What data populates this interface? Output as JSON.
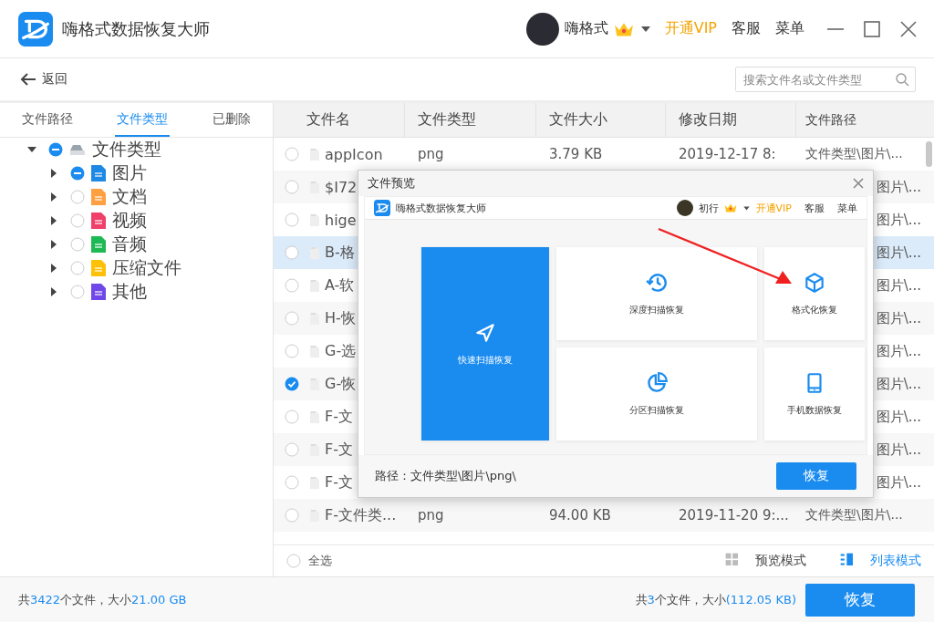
{
  "window": {
    "title": "嗨格式数据恢复大师",
    "user": "嗨格式",
    "vip": "开通VIP",
    "menus": [
      "客服",
      "菜单"
    ]
  },
  "toolbar": {
    "back": "返回",
    "search": {
      "placeholder": "搜索文件名或文件类型"
    }
  },
  "side_tabs": [
    {
      "label": "文件路径",
      "selected": false
    },
    {
      "label": "文件类型",
      "selected": true
    },
    {
      "label": "已删除",
      "selected": false
    }
  ],
  "tree": [
    {
      "label": "文件类型",
      "kind": "drive",
      "checked": true,
      "expanded": true,
      "children": [
        {
          "label": "图片",
          "kind": "file",
          "color": "#1e88e5",
          "checked": true,
          "expanded": false
        },
        {
          "label": "文档",
          "kind": "file",
          "color": "#ffa040",
          "checked": false,
          "expanded": false
        },
        {
          "label": "视频",
          "kind": "file",
          "color": "#f0406a",
          "checked": false,
          "expanded": false
        },
        {
          "label": "音频",
          "kind": "file",
          "color": "#1db954",
          "checked": false,
          "expanded": false
        },
        {
          "label": "压缩文件",
          "kind": "file",
          "color": "#ffc107",
          "checked": false,
          "expanded": false
        },
        {
          "label": "其他",
          "kind": "file",
          "color": "#7048e8",
          "checked": false,
          "expanded": false
        }
      ]
    }
  ],
  "table": {
    "columns": [
      "文件名",
      "文件类型",
      "文件大小",
      "修改日期",
      "文件路径"
    ],
    "rows": [
      {
        "name": "appIcon",
        "type": "png",
        "size": "3.79 KB",
        "modified": "2019-12-17 8:",
        "path": "文件类型\\图片\\...",
        "checked": false,
        "selected": false
      },
      {
        "name": "$I72",
        "path": "图片\\...",
        "checked": false,
        "selected": false
      },
      {
        "name": "hige",
        "path": "图片\\...",
        "checked": false,
        "selected": false
      },
      {
        "name": "B-格",
        "path": "图片\\...",
        "checked": false,
        "selected": true
      },
      {
        "name": "A-软",
        "path": "图片\\...",
        "checked": false,
        "selected": false
      },
      {
        "name": "H-恢",
        "path": "图片\\...",
        "checked": false,
        "selected": false
      },
      {
        "name": "G-选",
        "path": "图片\\...",
        "checked": false,
        "selected": false
      },
      {
        "name": "G-恢",
        "path": "图片\\...",
        "checked": true,
        "selected": false
      },
      {
        "name": "F-文",
        "path": "图片\\...",
        "checked": false,
        "selected": false
      },
      {
        "name": "F-文",
        "path": "图片\\...",
        "checked": false,
        "selected": false
      },
      {
        "name": "F-文",
        "path": "图片\\...",
        "checked": false,
        "selected": false
      },
      {
        "name": "F-文件类...",
        "type": "png",
        "size": "94.00 KB",
        "modified": "2019-11-20 9:...",
        "path": "文件类型\\图片\\...",
        "checked": false,
        "selected": false
      }
    ],
    "select_all": {
      "label": "全选",
      "checked": false
    },
    "view_modes": [
      {
        "label": "预览模式",
        "selected": false
      },
      {
        "label": "列表模式",
        "selected": true
      }
    ]
  },
  "dialog": {
    "title": "文件预览",
    "preview": {
      "app_title": "嗨格式数据恢复大师",
      "user": "初行",
      "vip": "开通VIP",
      "menus": [
        "客服",
        "菜单"
      ],
      "tiles": [
        {
          "label": "快速扫描恢复",
          "kind": "primary"
        },
        {
          "label": "深度扫描恢复",
          "kind": "card"
        },
        {
          "label": "格式化恢复",
          "kind": "card"
        },
        {
          "label": "分区扫描恢复",
          "kind": "card"
        },
        {
          "label": "手机数据恢复",
          "kind": "card"
        }
      ]
    },
    "path": "路径：文件类型\\图片\\png\\",
    "button": "恢复"
  },
  "status_bar": {
    "total": [
      {
        "text": "共",
        "accent": false
      },
      {
        "text": "3422",
        "accent": true
      },
      {
        "text": "个文件，大小",
        "accent": false
      },
      {
        "text": "21.00 GB",
        "accent": true
      }
    ],
    "selected": [
      {
        "text": "共",
        "accent": false
      },
      {
        "text": "3",
        "accent": true
      },
      {
        "text": "个文件，大小",
        "accent": false
      },
      {
        "text": "(112.05 KB)",
        "accent": true
      }
    ],
    "button": "恢复"
  }
}
